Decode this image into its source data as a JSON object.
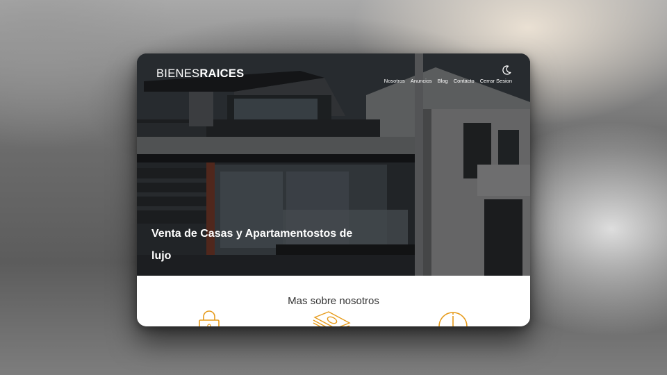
{
  "brand": {
    "light": "BIENES",
    "bold": "RAICES"
  },
  "header": {
    "dark_mode_icon": "moon-icon",
    "nav": [
      {
        "label": "Nosotros"
      },
      {
        "label": "Anuncios"
      },
      {
        "label": "Blog"
      },
      {
        "label": "Contacto"
      },
      {
        "label": "Cerrar Sesion"
      }
    ]
  },
  "hero": {
    "title": "Venta de Casas y Apartamentostos de lujo"
  },
  "about": {
    "title": "Mas sobre nosotros",
    "icons": [
      "lock-icon",
      "money-icon",
      "clock-icon"
    ]
  },
  "colors": {
    "accent": "#e69a19",
    "text_dark": "#333333",
    "hero_text": "#ffffff"
  }
}
